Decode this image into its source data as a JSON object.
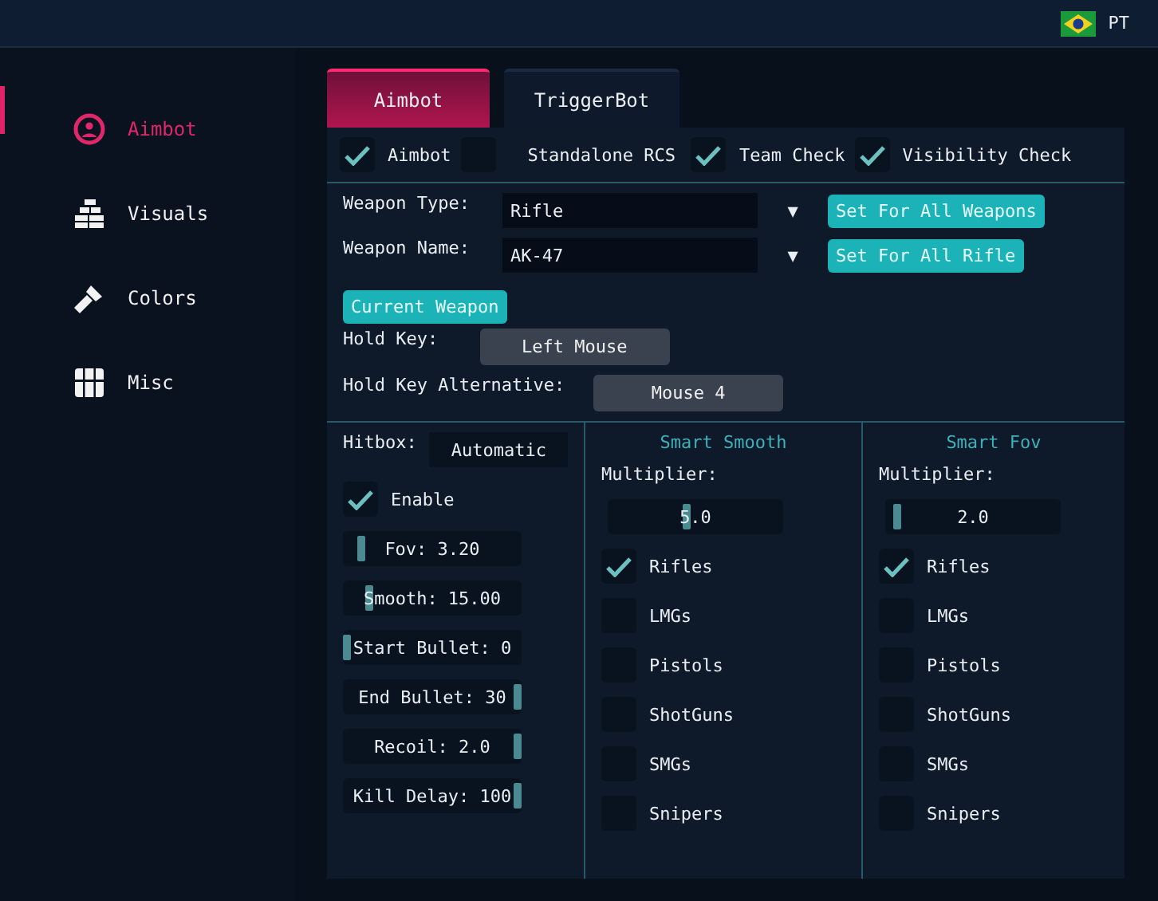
{
  "top_bar": {
    "language": "PT"
  },
  "sidebar": {
    "items": [
      {
        "label": "Aimbot",
        "selected": true
      },
      {
        "label": "Visuals",
        "selected": false
      },
      {
        "label": "Colors",
        "selected": false
      },
      {
        "label": "Misc",
        "selected": false
      }
    ]
  },
  "tabs": [
    {
      "label": "Aimbot",
      "selected": true
    },
    {
      "label": "TriggerBot",
      "selected": false
    }
  ],
  "toggles": [
    {
      "label": "Aimbot",
      "checked": true
    },
    {
      "label": "Standalone RCS",
      "checked": false
    },
    {
      "label": "Team Check",
      "checked": true
    },
    {
      "label": "Visibility Check",
      "checked": true
    }
  ],
  "weapon_type": {
    "label": "Weapon Type:",
    "value": "Rifle",
    "arrow": "▼",
    "button": "Set For All Weapons"
  },
  "weapon_name": {
    "label": "Weapon Name:",
    "value": "AK-47",
    "arrow": "▼",
    "button": "Set For All Rifle"
  },
  "current_weapon_button": "Current Weapon",
  "hold_key": {
    "label": "Hold Key:",
    "value": "Left Mouse"
  },
  "hold_key_alt": {
    "label": "Hold Key Alternative:",
    "value": "Mouse 4"
  },
  "hitbox": {
    "label": "Hitbox:",
    "value": "Automatic"
  },
  "enable": {
    "label": "Enable",
    "checked": true
  },
  "sliders": [
    {
      "text": "Fov: 3.20",
      "level": 0.08
    },
    {
      "text": "Smooth: 15.00",
      "level": 0.13
    },
    {
      "text": "Start Bullet: 0",
      "level": 0
    },
    {
      "text": "End Bullet: 30",
      "level": 1
    },
    {
      "text": "Recoil: 2.0",
      "level": 1
    },
    {
      "text": "Kill Delay: 100",
      "level": 1
    }
  ],
  "smart_smooth": {
    "title": "Smart Smooth",
    "multiplier_label": "Multiplier:",
    "multiplier": {
      "text": "5.0",
      "level": 0.45
    },
    "weapons": [
      {
        "label": "Rifles",
        "checked": true
      },
      {
        "label": "LMGs",
        "checked": false
      },
      {
        "label": "Pistols",
        "checked": false
      },
      {
        "label": "ShotGuns",
        "checked": false
      },
      {
        "label": "SMGs",
        "checked": false
      },
      {
        "label": "Snipers",
        "checked": false
      }
    ]
  },
  "smart_fov": {
    "title": "Smart Fov",
    "multiplier_label": "Multiplier:",
    "multiplier": {
      "text": "2.0",
      "level": 0.05
    },
    "weapons": [
      {
        "label": "Rifles",
        "checked": true
      },
      {
        "label": "LMGs",
        "checked": false
      },
      {
        "label": "Pistols",
        "checked": false
      },
      {
        "label": "ShotGuns",
        "checked": false
      },
      {
        "label": "SMGs",
        "checked": false
      },
      {
        "label": "Snipers",
        "checked": false
      }
    ]
  }
}
